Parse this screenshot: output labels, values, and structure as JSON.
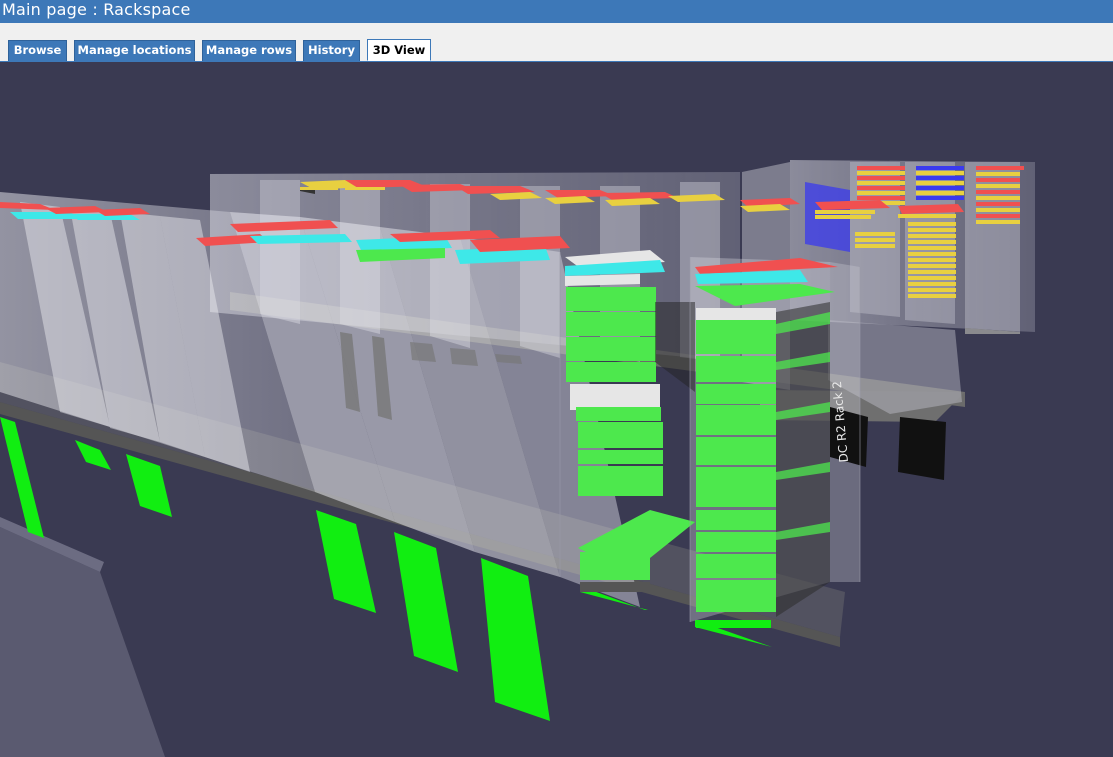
{
  "header": {
    "title": "Main page : Rackspace"
  },
  "tabs": [
    {
      "label": "Browse",
      "active": false
    },
    {
      "label": "Manage locations",
      "active": false
    },
    {
      "label": "Manage rows",
      "active": false
    },
    {
      "label": "History",
      "active": false
    },
    {
      "label": "3D View",
      "active": true
    }
  ],
  "scene": {
    "rack_label": "DC R2 Rack 2",
    "colors": {
      "background": "#3a3a52",
      "server_green": "#4de84d",
      "server_cyan": "#3ee8e8",
      "server_red": "#f05050",
      "server_yellow": "#e8d040",
      "server_blue": "#3a3aee",
      "server_white": "#e6e6e6",
      "label_green": "#11ee11"
    }
  }
}
